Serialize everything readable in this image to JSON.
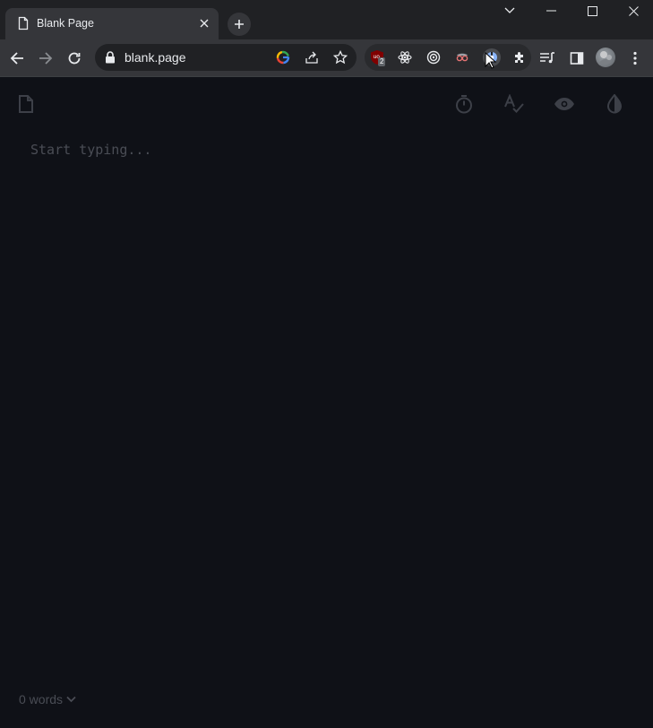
{
  "browser": {
    "tab": {
      "title": "Blank Page",
      "favicon": "document-icon"
    },
    "new_tab_icon": "plus-icon",
    "window_controls": [
      "chevron-down-icon",
      "minimize-icon",
      "maximize-icon",
      "close-icon"
    ],
    "address_bar": {
      "url": "blank.page",
      "secure_icon": "lock-icon"
    },
    "extensions": {
      "ublock_badge": "2"
    }
  },
  "page": {
    "editor": {
      "placeholder": "Start typing...",
      "value": ""
    },
    "toolbar": [
      "timer-icon",
      "spellcheck-icon",
      "preview-eye-icon",
      "contrast-icon"
    ],
    "footer": {
      "word_count": "0 words"
    }
  },
  "colors": {
    "chrome_bg": "#202124",
    "toolbar_bg": "#35363a",
    "page_bg": "#0f1117",
    "icon_dim": "#3d4048",
    "text_dim": "#4a4d55"
  }
}
